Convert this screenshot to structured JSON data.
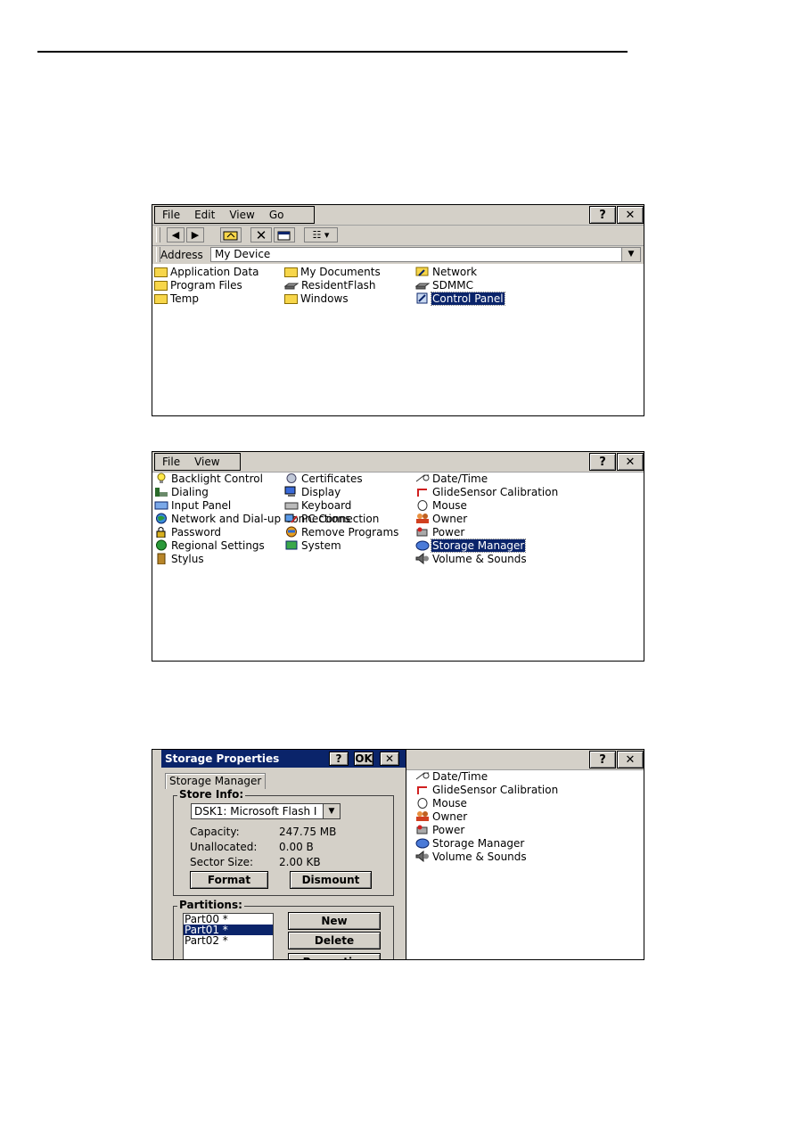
{
  "shot1": {
    "menus": [
      "File",
      "Edit",
      "View",
      "Go"
    ],
    "help": "?",
    "close": "✕",
    "address_label": "Address",
    "address_value": "My Device",
    "items": [
      {
        "label": "Application Data",
        "icon": "folder-icon"
      },
      {
        "label": "Program Files",
        "icon": "folder-icon"
      },
      {
        "label": "Temp",
        "icon": "folder-icon"
      },
      {
        "label": "My Documents",
        "icon": "folder-icon"
      },
      {
        "label": "ResidentFlash",
        "icon": "drive-icon"
      },
      {
        "label": "Windows",
        "icon": "folder-icon"
      },
      {
        "label": "Network",
        "icon": "network-folder-icon"
      },
      {
        "label": "SDMMC",
        "icon": "drive-icon"
      },
      {
        "label": "Control Panel",
        "icon": "control-panel-icon"
      }
    ]
  },
  "shot2": {
    "menus": [
      "File",
      "View"
    ],
    "help": "?",
    "close": "✕",
    "items": [
      "Backlight Control",
      "Dialing",
      "Input Panel",
      "Network and Dial-up Connections",
      "Password",
      "Regional Settings",
      "Stylus",
      "Certificates",
      "Display",
      "Keyboard",
      "PC Connection",
      "Remove Programs",
      "System",
      "Date/Time",
      "GlideSensor Calibration",
      "Mouse",
      "Owner",
      "Power",
      "Storage Manager",
      "Volume & Sounds"
    ]
  },
  "shot3": {
    "dialog_title": "Storage Properties",
    "help": "?",
    "ok": "OK",
    "close": "✕",
    "tab": "Storage Manager",
    "store_info_title": "Store Info:",
    "store_select": "DSK1: Microsoft Flash I",
    "capacity_label": "Capacity:",
    "capacity_value": "247.75 MB",
    "unallocated_label": "Unallocated:",
    "unallocated_value": "0.00 B",
    "sector_label": "Sector Size:",
    "sector_value": "2.00 KB",
    "format_button": "Format",
    "dismount_button": "Dismount",
    "partitions_title": "Partitions:",
    "partitions": [
      "Part00 *",
      "Part01 *",
      "Part02 *"
    ],
    "new_button": "New",
    "delete_button": "Delete",
    "properties_button": "Properties",
    "right_items": [
      "Date/Time",
      "GlideSensor Calibration",
      "Mouse",
      "Owner",
      "Power",
      "Storage Manager",
      "Volume & Sounds"
    ]
  }
}
